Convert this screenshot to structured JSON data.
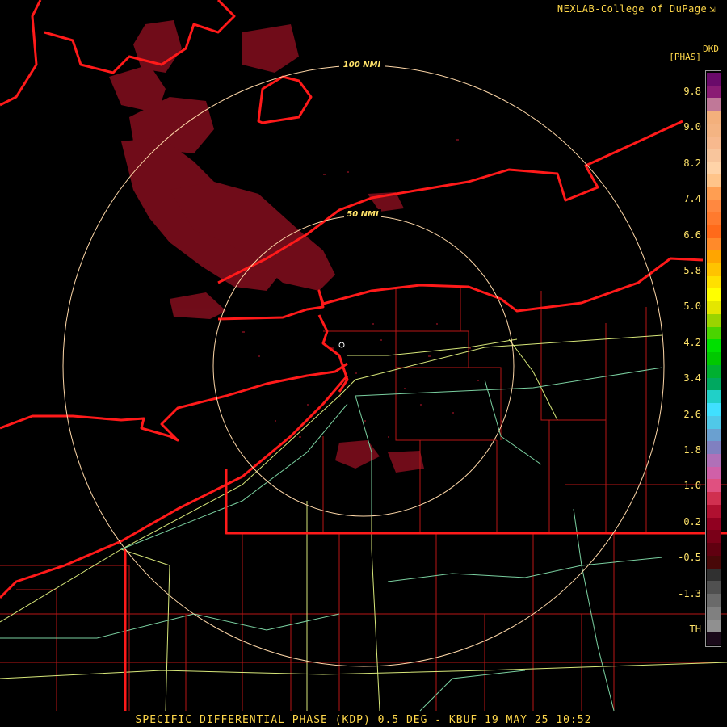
{
  "header": {
    "credit": "NEXLAB-College of DuPage",
    "credit_mark": "⇲"
  },
  "footer": {
    "caption": "SPECIFIC DIFFERENTIAL PHASE (KDP) 0.5 DEG - KBUF 19 MAY 25 10:52"
  },
  "range_rings": [
    {
      "label": "100 NMI"
    },
    {
      "label": "50 NMI"
    }
  ],
  "legend": {
    "abbr": "DKD",
    "unit": "[PHAS]",
    "ticks": [
      "9.8",
      "9.0",
      "8.2",
      "7.4",
      "6.6",
      "5.8",
      "5.0",
      "4.2",
      "3.4",
      "2.6",
      "1.8",
      "1.0",
      "0.2",
      "-0.5",
      "-1.3",
      "TH"
    ],
    "swatches": [
      "#6a0a6a",
      "#8a1b74",
      "#c07898",
      "#f3b07c",
      "#f4b483",
      "#f7b98e",
      "#f8c59c",
      "#ffd3a8",
      "#ffc48a",
      "#ff9e52",
      "#ff8840",
      "#ff7a2e",
      "#ff6a1a",
      "#ff8a2a",
      "#ffa500",
      "#ffc300",
      "#ffe000",
      "#ffff00",
      "#e4e600",
      "#9ad400",
      "#4ad400",
      "#00e000",
      "#00c800",
      "#00b030",
      "#00a860",
      "#20d0c8",
      "#40e0ff",
      "#50c8e8",
      "#6aa0d0",
      "#8080c0",
      "#b070b8",
      "#d060a8",
      "#e05080",
      "#d03050",
      "#b01030",
      "#900020",
      "#7a0018",
      "#600010",
      "#480808",
      "#303030",
      "#505050",
      "#6a6a6a",
      "#808080",
      "#909090",
      "#1a0a1a"
    ],
    "colors": {
      "text": "#ffe36a",
      "border": "#999999"
    }
  },
  "colors": {
    "background": "#000000",
    "state_border": "#ff1a1a",
    "county_border": "#c01818",
    "highway": "#d8e87a",
    "highway_alt": "#7ad0a0",
    "ring": "#ffd8a8",
    "echo": "#8a1020"
  }
}
